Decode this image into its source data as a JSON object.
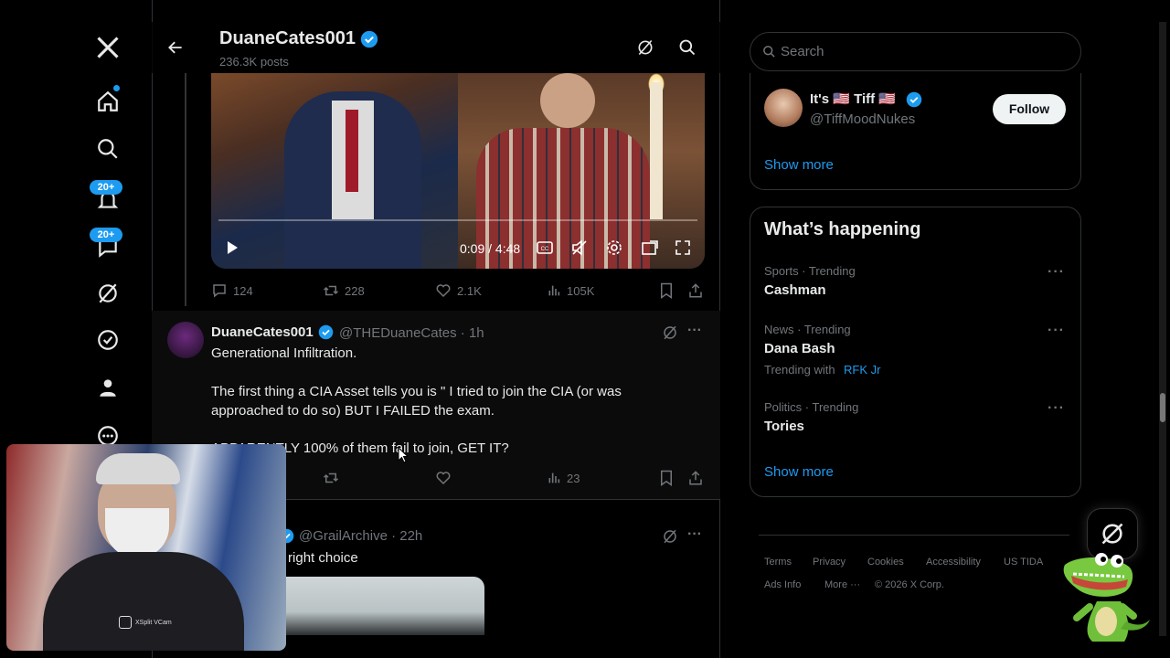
{
  "nav": {
    "badges": [
      "20+",
      "20+"
    ]
  },
  "header": {
    "name": "DuaneCates001",
    "posts": "236.3K posts"
  },
  "video": {
    "time": "0:09 / 4:48"
  },
  "post_actions": {
    "replies": "124",
    "reposts": "228",
    "likes": "2.1K",
    "views": "105K"
  },
  "tweet": {
    "name": "DuaneCates001",
    "handle_time": "@THEDuaneCates · 1h",
    "line1": "Generational Infiltration.",
    "line2": "The first thing a CIA Asset tells you is \" I tried to join the CIA (or was",
    "line3": "approached to do so) BUT I FAILED the exam.",
    "line4": "APPARENTLY 100% of them fail to join, GET IT?",
    "views": "23"
  },
  "tweet2": {
    "handle_time": "@GrailArchive · 22h",
    "text": "the right choice"
  },
  "sidebar": {
    "search_placeholder": "Search",
    "who_to_follow": {
      "name": "It's 🇺🇸 Tiff 🇺🇸",
      "handle": "@TiffMoodNukes",
      "follow_label": "Follow",
      "show_more": "Show more"
    },
    "happening": {
      "title": "What’s happening",
      "trends": [
        {
          "category": "Sports · Trending",
          "name": "Cashman"
        },
        {
          "category": "News · Trending",
          "name": "Dana Bash",
          "with_label": "Trending with",
          "with_link": "RFK Jr"
        },
        {
          "category": "Politics · Trending",
          "name": "Tories"
        }
      ],
      "show_more": "Show more"
    },
    "footer": {
      "terms": "Terms",
      "privacy": "Privacy",
      "cookies": "Cookies",
      "accessibility": "Accessibility",
      "us_tida": "US TIDA",
      "ads_info": "Ads Info",
      "more": "More ···",
      "copyright": "© 2026 X Corp."
    }
  },
  "webcam": {
    "label": "XSplit VCam"
  },
  "colors": {
    "accent": "#1d9bf0",
    "background": "#000000",
    "text": "#e7e9ea",
    "muted": "#71767b",
    "border": "#2f3336"
  }
}
